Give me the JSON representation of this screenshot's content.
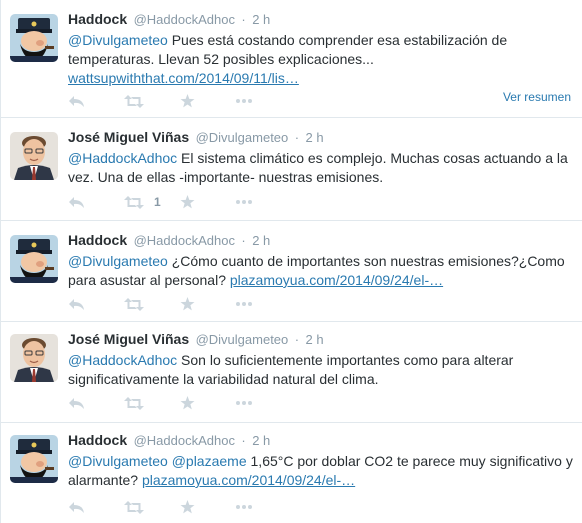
{
  "tweets": [
    {
      "avatar": "haddock-captain-avatar",
      "fullname": "Haddock",
      "username": "@HaddockAdhoc",
      "time": "2 h",
      "mention": "@Divulgameteo",
      "mention2": "",
      "text": " Pues está costando comprender esa estabilización de temperaturas. Llevan 52 posibles explicaciones... ",
      "url": "wattsupwiththat.com/2014/09/11/lis…",
      "retweet_count": "",
      "view_summary": "Ver resumen"
    },
    {
      "avatar": "jose-miguel-avatar",
      "fullname": "José Miguel Viñas",
      "username": "@Divulgameteo",
      "time": "2 h",
      "mention": "@HaddockAdhoc",
      "mention2": "",
      "text": " El sistema climático es complejo. Muchas cosas actuando a la vez. Una de ellas -importante- nuestras emisiones.",
      "url": "",
      "retweet_count": "1",
      "view_summary": ""
    },
    {
      "avatar": "haddock-captain-avatar",
      "fullname": "Haddock",
      "username": "@HaddockAdhoc",
      "time": "2 h",
      "mention": "@Divulgameteo",
      "mention2": "",
      "text": " ¿Cómo cuanto de importantes son nuestras emisiones?¿Como para asustar al personal? ",
      "url": "plazamoyua.com/2014/09/24/el-…",
      "retweet_count": "",
      "view_summary": ""
    },
    {
      "avatar": "jose-miguel-avatar",
      "fullname": "José Miguel Viñas",
      "username": "@Divulgameteo",
      "time": "2 h",
      "mention": "@HaddockAdhoc",
      "mention2": "",
      "text": " Son lo suficientemente importantes como para alterar significativamente la variabilidad natural del clima.",
      "url": "",
      "retweet_count": "",
      "view_summary": ""
    },
    {
      "avatar": "haddock-captain-avatar",
      "fullname": "Haddock",
      "username": "@HaddockAdhoc",
      "time": "2 h",
      "mention": "@Divulgameteo",
      "mention2": "@plazaeme",
      "text": " 1,65°C por doblar CO2 te parece muy significativo y alarmante? ",
      "url": "plazamoyua.com/2014/09/24/el-…",
      "retweet_count": "",
      "view_summary": ""
    }
  ],
  "separator": "·",
  "colors": {
    "link": "#2a7ab0",
    "secondary_text": "#8899a6",
    "icon": "#ccd6dd",
    "divider": "#e1e8ed"
  },
  "icons": [
    "reply-icon",
    "retweet-icon",
    "favorite-star-icon",
    "more-dots-icon"
  ]
}
